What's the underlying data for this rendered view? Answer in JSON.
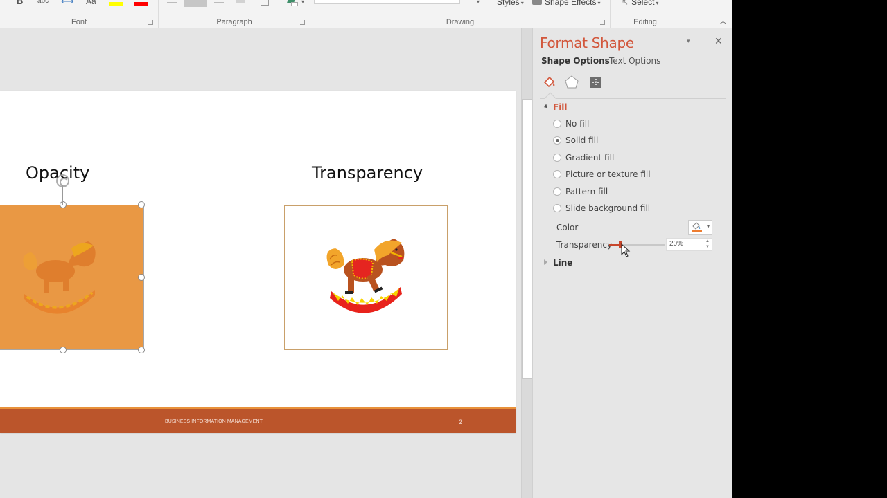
{
  "ribbon": {
    "groups": [
      {
        "label": "Font"
      },
      {
        "label": "Paragraph"
      },
      {
        "label": "Drawing"
      },
      {
        "label": "Editing"
      }
    ],
    "font_icons": [
      "bold-icon",
      "strikethrough-icon",
      "character-spacing-icon",
      "change-case-icon",
      "highlight-color-icon",
      "font-color-icon"
    ],
    "font_text": {
      "strike": "abc",
      "case": "Aa"
    },
    "highlight_color": "#ffff00",
    "font_color": "#ff0000",
    "drawing_buttons": {
      "styles": "Styles",
      "shape_effects": "Shape Effects"
    },
    "editing_buttons": {
      "select": "Select"
    }
  },
  "slide": {
    "left_title": "Opacity",
    "right_title": "Transparency",
    "footer_text": "BUSINESS INFORMATION MANAGEMENT",
    "page_number": "2",
    "opacity_fill_color": "#e99844",
    "footer_color": "#bb552b",
    "footer_accent_color": "#e8913a"
  },
  "scrollbar": {
    "position_fraction": 0.37
  },
  "format_pane": {
    "title": "Format Shape",
    "tabs": [
      {
        "label": "Shape Options",
        "active": true
      },
      {
        "label": "Text Options",
        "active": false
      }
    ],
    "categories": [
      "fill-line-icon",
      "effects-icon",
      "size-properties-icon"
    ],
    "fill_section": {
      "label": "Fill",
      "expanded": true,
      "options": [
        {
          "label": "No fill",
          "checked": false
        },
        {
          "label": "Solid fill",
          "checked": true
        },
        {
          "label": "Gradient fill",
          "checked": false
        },
        {
          "label": "Picture or texture fill",
          "checked": false
        },
        {
          "label": "Pattern fill",
          "checked": false
        },
        {
          "label": "Slide background fill",
          "checked": false
        }
      ],
      "color_label": "Color",
      "color_value": "#ed7d31",
      "transparency_label": "Transparency",
      "transparency_value": "20%",
      "transparency_fraction": 0.2
    },
    "line_section": {
      "label": "Line",
      "expanded": false
    },
    "accent_color": "#d2573c",
    "slider_color": "#c8462b"
  }
}
